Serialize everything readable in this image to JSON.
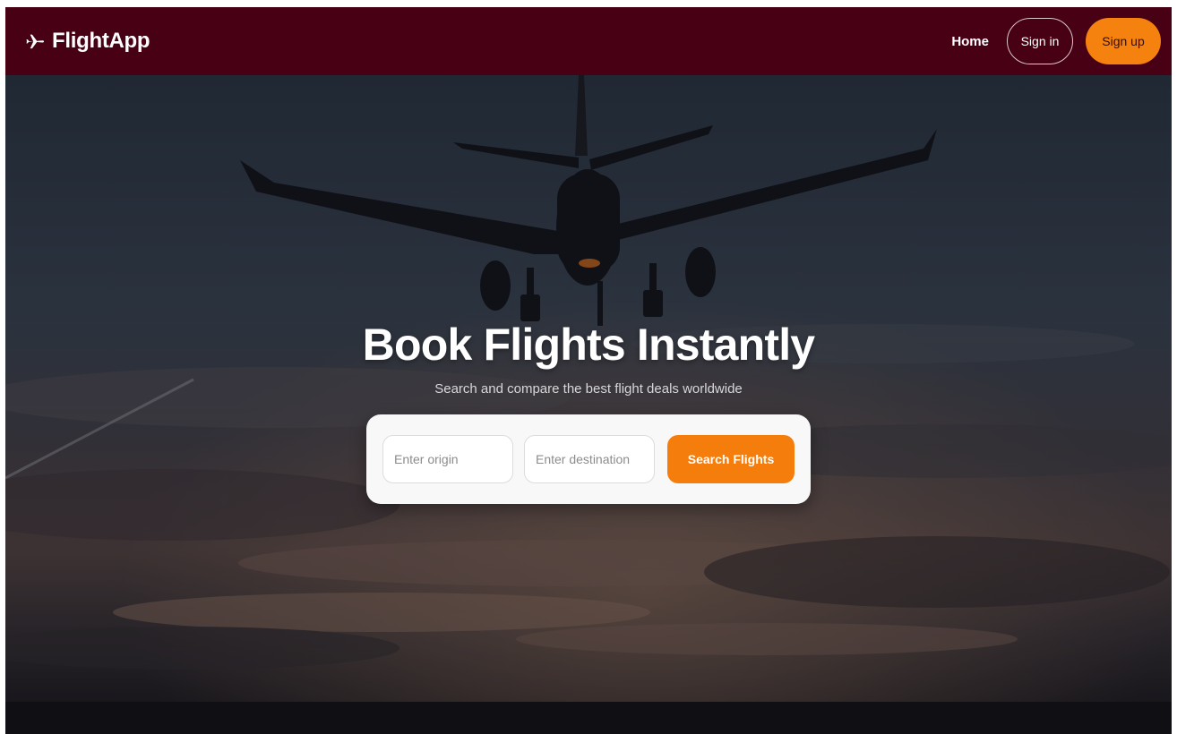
{
  "header": {
    "brand_name": "FlightApp",
    "brand_icon": "airplane-icon",
    "nav": {
      "home_label": "Home",
      "signin_label": "Sign in",
      "signup_label": "Sign up"
    }
  },
  "hero": {
    "title": "Book Flights Instantly",
    "subtitle": "Search and compare the best flight deals worldwide",
    "background_image": "airplane landing at dusk"
  },
  "search": {
    "origin_placeholder": "Enter origin",
    "origin_value": "",
    "destination_placeholder": "Enter destination",
    "destination_value": "",
    "submit_label": "Search Flights"
  },
  "colors": {
    "header_bg": "#470014",
    "accent_orange": "#f5820e",
    "card_bg": "#f8f8f8"
  }
}
